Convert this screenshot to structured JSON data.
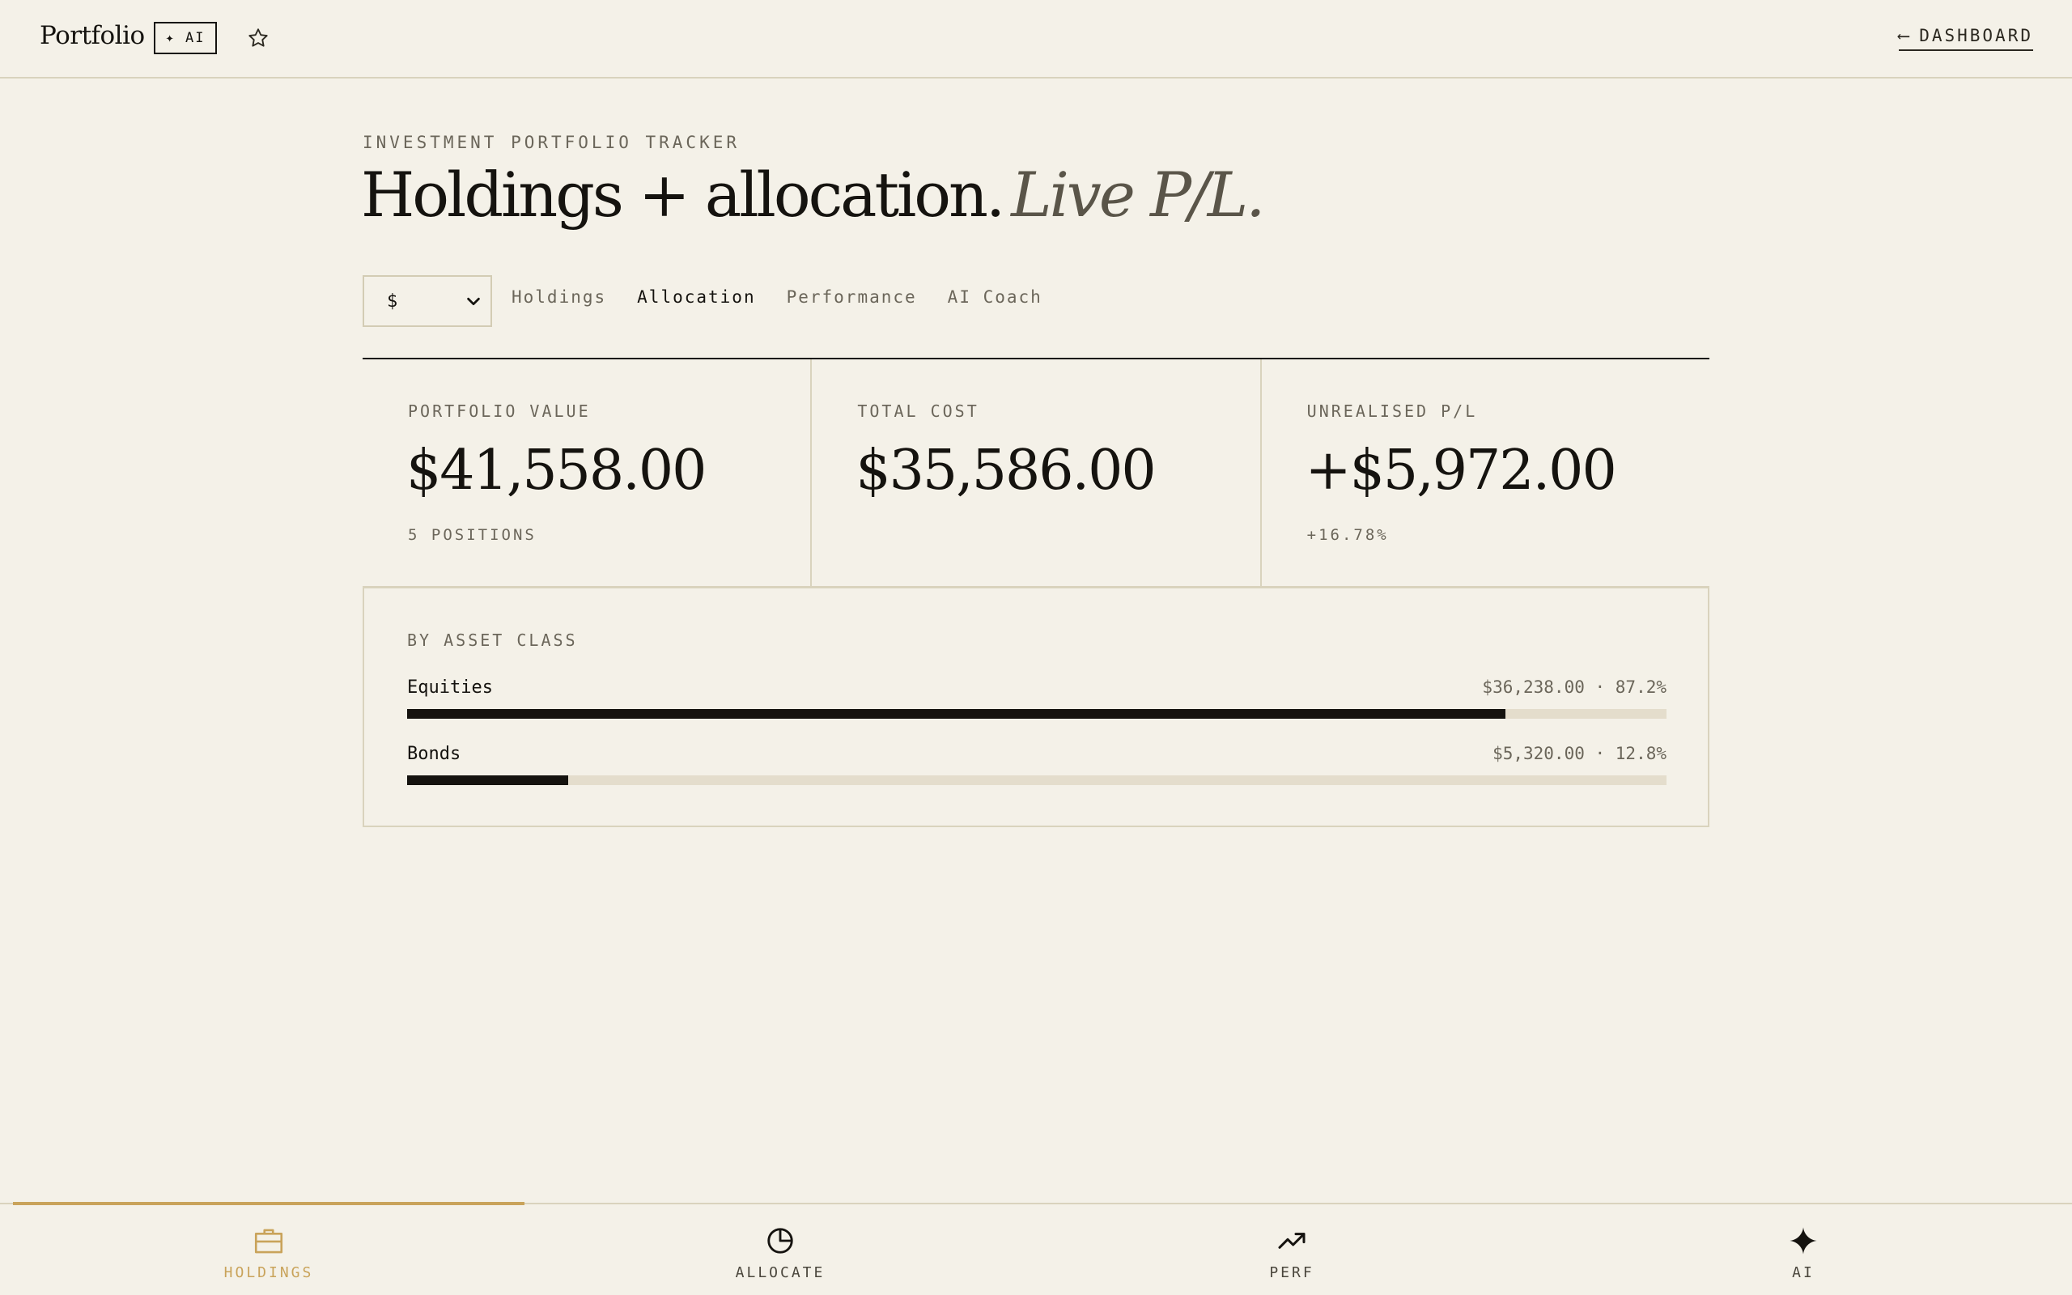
{
  "topbar": {
    "brand": "Portfolio",
    "ai_badge": "✦ AI",
    "back_arrow": "⟵",
    "dashboard_link": "DASHBOARD"
  },
  "header": {
    "eyebrow": "INVESTMENT PORTFOLIO TRACKER",
    "title": "Holdings + allocation.",
    "title_accent": "Live P/L."
  },
  "controls": {
    "currency_value": "$",
    "tabs": [
      {
        "label": "Holdings",
        "active": false
      },
      {
        "label": "Allocation",
        "active": true
      },
      {
        "label": "Performance",
        "active": false
      },
      {
        "label": "AI Coach",
        "active": false
      }
    ]
  },
  "stats": [
    {
      "label": "PORTFOLIO VALUE",
      "value": "$41,558.00",
      "sub": "5 POSITIONS"
    },
    {
      "label": "TOTAL COST",
      "value": "$35,586.00",
      "sub": ""
    },
    {
      "label": "UNREALISED P/L",
      "value": "+$5,972.00",
      "sub": "+16.78%"
    }
  ],
  "asset_class": {
    "title": "BY ASSET CLASS",
    "rows": [
      {
        "name": "Equities",
        "meta": "$36,238.00 · 87.2%",
        "fraction": 0.872
      },
      {
        "name": "Bonds",
        "meta": "$5,320.00 · 12.8%",
        "fraction": 0.128
      }
    ]
  },
  "bottom_nav": [
    {
      "label": "HOLDINGS",
      "icon": "briefcase-icon",
      "active": true
    },
    {
      "label": "ALLOCATE",
      "icon": "pie-chart-icon",
      "active": false
    },
    {
      "label": "PERF",
      "icon": "trending-up-icon",
      "active": false
    },
    {
      "label": "AI",
      "icon": "sparkle-icon",
      "active": false
    }
  ],
  "colors": {
    "background": "#f4f1e8",
    "ink": "#15130f",
    "muted": "#6b665a",
    "accent": "#c9a35a",
    "border": "#d9d3bd",
    "track": "#e4ddcc"
  }
}
